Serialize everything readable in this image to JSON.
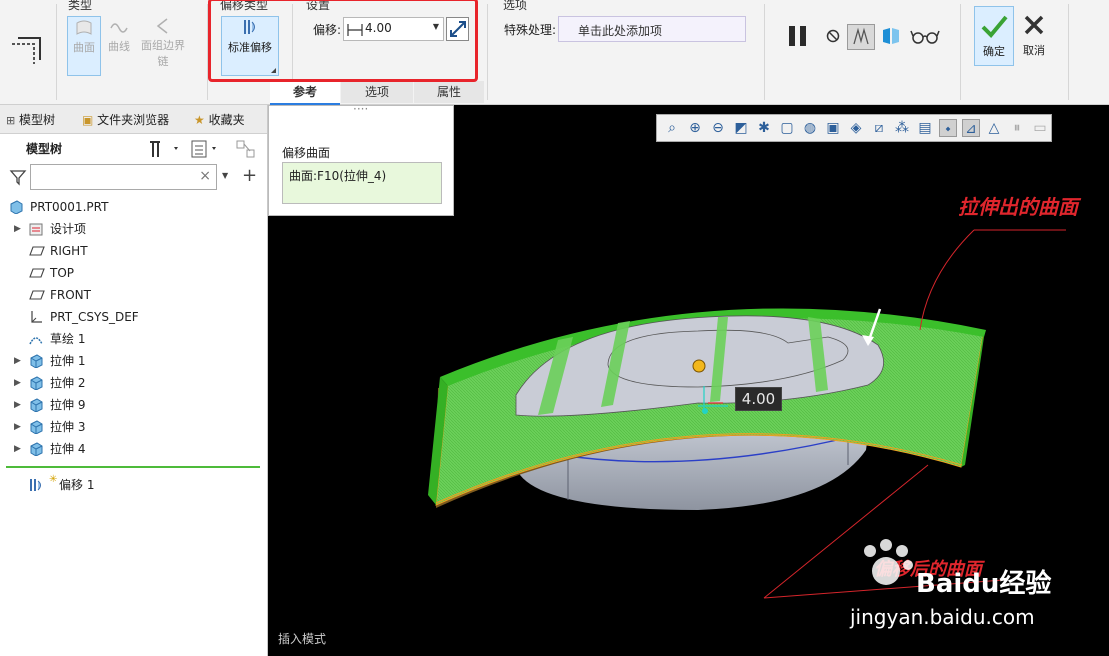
{
  "ribbon": {
    "groups": {
      "type": "类型",
      "offset_type": "偏移类型",
      "settings": "设置",
      "options": "选项"
    },
    "type_buttons": [
      {
        "label": "曲面",
        "state": "selected-disabled"
      },
      {
        "label": "曲线",
        "state": "disabled"
      },
      {
        "label": "面组边界链",
        "state": "disabled"
      }
    ],
    "offset_type_button": "标准偏移",
    "offset_label": "偏移:",
    "offset_value": "4.00",
    "special_label": "特殊处理:",
    "special_placeholder": "单击此处添加项",
    "confirm": "确定",
    "cancel": "取消",
    "subtabs": [
      "参考",
      "选项",
      "属性"
    ]
  },
  "left_panel": {
    "tabs": [
      "模型树",
      "文件夹浏览器",
      "收藏夹"
    ],
    "tree_header": "模型树",
    "filter_placeholder": "",
    "root": "PRT0001.PRT",
    "items": [
      {
        "label": "设计项",
        "icon": "design-items-icon",
        "expandable": true
      },
      {
        "label": "RIGHT",
        "icon": "datum-plane-icon",
        "expandable": false
      },
      {
        "label": "TOP",
        "icon": "datum-plane-icon",
        "expandable": false
      },
      {
        "label": "FRONT",
        "icon": "datum-plane-icon",
        "expandable": false
      },
      {
        "label": "PRT_CSYS_DEF",
        "icon": "csys-icon",
        "expandable": false
      },
      {
        "label": "草绘 1",
        "icon": "sketch-icon",
        "expandable": false
      },
      {
        "label": "拉伸 1",
        "icon": "extrude-icon",
        "expandable": true
      },
      {
        "label": "拉伸 2",
        "icon": "extrude-icon",
        "expandable": true
      },
      {
        "label": "拉伸 9",
        "icon": "extrude-icon",
        "expandable": true
      },
      {
        "label": "拉伸 3",
        "icon": "extrude-icon",
        "expandable": true
      },
      {
        "label": "拉伸 4",
        "icon": "extrude-icon",
        "expandable": true
      }
    ],
    "insert_item": "偏移 1"
  },
  "reference_panel": {
    "title": "偏移曲面",
    "value": "曲面:F10(拉伸_4)"
  },
  "viewport": {
    "dimension_label": "4.00",
    "annotation_top": "拉伸出的曲面",
    "annotation_bottom": "偏移后的曲面",
    "status": "插入模式",
    "watermark_text": "Baidu经验",
    "watermark_url": "jingyan.baidu.com"
  },
  "colors": {
    "accent": "#2b7de0",
    "highlight": "#e8242b",
    "surface_green": "#3bbf2b",
    "annotation_red": "#e0262d"
  }
}
